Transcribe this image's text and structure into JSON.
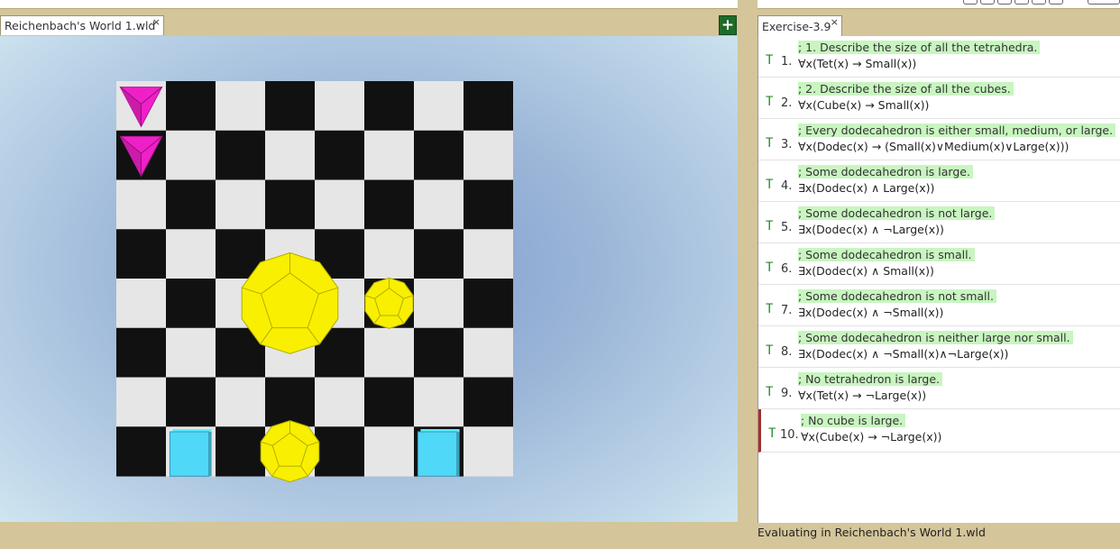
{
  "world": {
    "tab_title": "Reichenbach's World 1.wld",
    "close_glyph": "×",
    "add_glyph": "+",
    "board_light_color": "#e6e6e6",
    "board_dark_color": "#111111",
    "blocks": [
      {
        "shape": "tet",
        "size": "small",
        "col": 0,
        "row": 0,
        "color": "#f020c8"
      },
      {
        "shape": "tet",
        "size": "small",
        "col": 0,
        "row": 1,
        "color": "#f020c8"
      },
      {
        "shape": "dodec",
        "size": "large",
        "col": 3,
        "row": 4,
        "color": "#f8f000"
      },
      {
        "shape": "dodec",
        "size": "small",
        "col": 5,
        "row": 4,
        "color": "#f8f000"
      },
      {
        "shape": "dodec",
        "size": "medium",
        "col": 3,
        "row": 7,
        "color": "#f8f000"
      },
      {
        "shape": "cube",
        "size": "small",
        "col": 1,
        "row": 7,
        "color": "#50d8f8"
      },
      {
        "shape": "cube",
        "size": "small",
        "col": 6,
        "row": 7,
        "color": "#50d8f8"
      }
    ]
  },
  "exercise": {
    "tab_title": "Exercise-3.9",
    "close_glyph": "×",
    "sentences": [
      {
        "truth": "T",
        "num": "1.",
        "comment": "; 1. Describe the size of all the tetrahedra.",
        "formula": "∀x(Tet(x) → Small(x))"
      },
      {
        "truth": "T",
        "num": "2.",
        "comment": "; 2. Describe the size of all the cubes.",
        "formula": "∀x(Cube(x) → Small(x))"
      },
      {
        "truth": "T",
        "num": "3.",
        "comment": "; Every dodecahedron is either small, medium, or large.",
        "formula": "∀x(Dodec(x) → (Small(x)∨Medium(x)∨Large(x)))"
      },
      {
        "truth": "T",
        "num": "4.",
        "comment": "; Some dodecahedron is large.",
        "formula": "∃x(Dodec(x) ∧ Large(x))"
      },
      {
        "truth": "T",
        "num": "5.",
        "comment": "; Some dodecahedron is not large.",
        "formula": "∃x(Dodec(x) ∧ ¬Large(x))"
      },
      {
        "truth": "T",
        "num": "6.",
        "comment": "; Some dodecahedron is small.",
        "formula": "∃x(Dodec(x) ∧ Small(x))"
      },
      {
        "truth": "T",
        "num": "7.",
        "comment": "; Some dodecahedron is not small.",
        "formula": "∃x(Dodec(x) ∧ ¬Small(x))"
      },
      {
        "truth": "T",
        "num": "8.",
        "comment": "; Some dodecahedron is neither large nor small.",
        "formula": "∃x(Dodec(x) ∧ ¬Small(x)∧¬Large(x))"
      },
      {
        "truth": "T",
        "num": "9.",
        "comment": "; No tetrahedron is large.",
        "formula": "∀x(Tet(x) → ¬Large(x))"
      },
      {
        "truth": "T",
        "num": "10.",
        "comment": "; No cube is large.",
        "formula": "∀x(Cube(x) → ¬Large(x))",
        "selected": true
      }
    ],
    "status": "Evaluating in Reichenbach's World 1.wld"
  }
}
